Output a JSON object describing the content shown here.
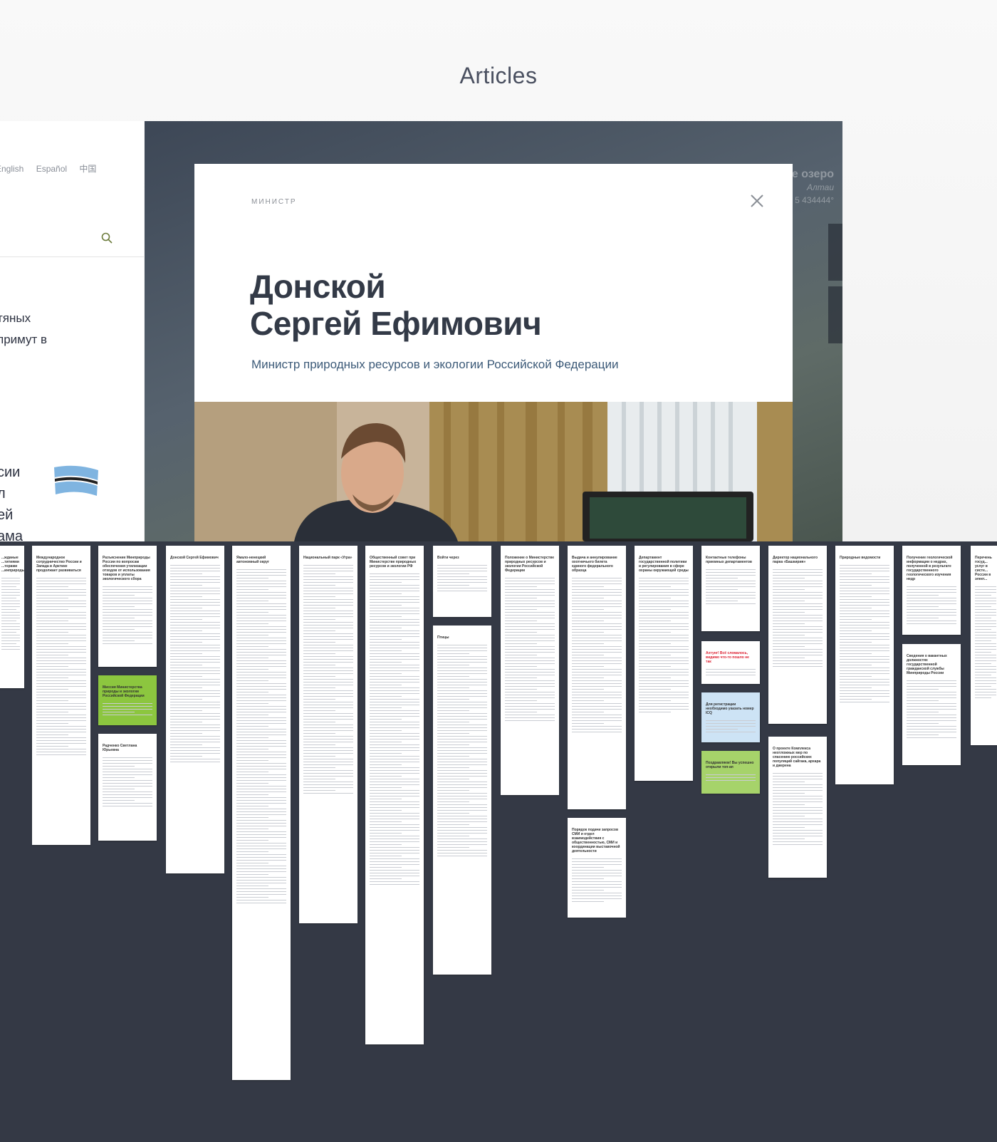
{
  "heading": "Articles",
  "site": {
    "languages": [
      "English",
      "Español",
      "中国"
    ],
    "news_line1": [
      "тяных",
      "примут в"
    ],
    "news_line2": [
      "сии",
      "л",
      "ей",
      "ама"
    ]
  },
  "hero": {
    "lake_title": "е озеро",
    "lake_sub": "Алтаи",
    "lake_num": "5 434444°"
  },
  "modal": {
    "label": "МИНИСТР",
    "name_line1": "Донской",
    "name_line2": "Сергей Ефимович",
    "role": "Министр природных ресурсов и экологии Российской Федерации"
  },
  "thumbnails": [
    {
      "title": "...жданые ...титиями ...торами ...инприроды"
    },
    {
      "title": "Международное сотрудничество России и Запада в Арктике продолжает развиваться"
    },
    {
      "title": "Разъяснение Минприроды России по вопросам обеспечения утилизации отходов от использования товаров и уплаты экологического сбора"
    },
    {
      "title": "Донской Сергей Ефимович"
    },
    {
      "title": "Ямало-ненецкий автономный округ"
    },
    {
      "title": "Национальный парк «Угра»"
    },
    {
      "title": "Общественный совет при Министерстве природных ресурсов и экологии РФ"
    },
    {
      "title": "Войти через"
    },
    {
      "title": "Положение о Министерстве природных ресурсов и экологии Российской Федерации"
    },
    {
      "title": "Выдача и аннулирование охотничьего билета единого федерального образца"
    },
    {
      "title": "Департамент государственной политики и регулирования в сфере охраны окружающей среды"
    },
    {
      "title": "Контактные телефоны приемных департаментов"
    },
    {
      "title": "Директор национального парка «Башкирия»"
    },
    {
      "title": "Природные ведомости"
    },
    {
      "title": "Получение геологической информации о недрах, полученной в результате государственного геологического изучения недр"
    },
    {
      "title": "Перечень госуд... услуг в систе... России в элект..."
    }
  ],
  "extra_thumbs": {
    "mission": "Миссия Министерства природы и экологии Российской Федерации",
    "radchenko": "Радченко Светлана Юрьевна",
    "birds": "Птицы",
    "order": "Порядок подачи запросов СМИ и отдел взаимодействия с общественностью, СМИ и координации выставочной деятельности",
    "alert": "Ахтунг! Всё сломалось, видимо что-то пошло не так",
    "register": "Для регистрации необходимо указать номер ICQ",
    "congrats": "Поздравляем! Вы успешно открыли топ-ап",
    "complex": "О проекте Комплекса неотложных мер по спасению российских популяций сайгака, архара и джерена",
    "vacancies": "Сведения о вакантных должностях государственной гражданской службы Минприроды России",
    "vedomosti": "Природные ВЕДОМОСТИ"
  }
}
